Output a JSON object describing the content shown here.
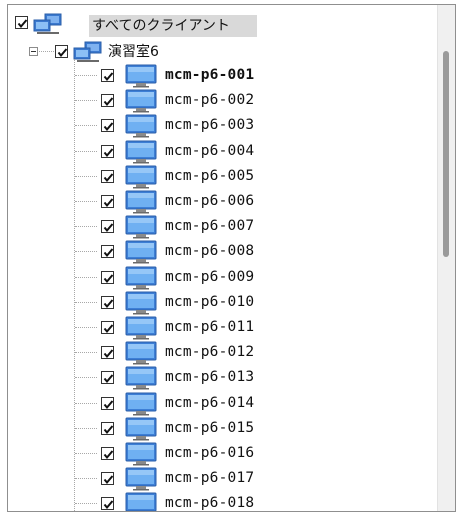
{
  "tree": {
    "root": {
      "label": "すべてのクライアント",
      "checked": true,
      "icon": "network-computers-icon"
    },
    "group": {
      "label": "演習室6",
      "checked": true,
      "expanded": true,
      "icon": "network-computers-icon"
    },
    "clients": [
      {
        "label": "mcm-p6-001",
        "checked": true,
        "selected": true
      },
      {
        "label": "mcm-p6-002",
        "checked": true
      },
      {
        "label": "mcm-p6-003",
        "checked": true
      },
      {
        "label": "mcm-p6-004",
        "checked": true
      },
      {
        "label": "mcm-p6-005",
        "checked": true
      },
      {
        "label": "mcm-p6-006",
        "checked": true
      },
      {
        "label": "mcm-p6-007",
        "checked": true
      },
      {
        "label": "mcm-p6-008",
        "checked": true
      },
      {
        "label": "mcm-p6-009",
        "checked": true
      },
      {
        "label": "mcm-p6-010",
        "checked": true
      },
      {
        "label": "mcm-p6-011",
        "checked": true
      },
      {
        "label": "mcm-p6-012",
        "checked": true
      },
      {
        "label": "mcm-p6-013",
        "checked": true
      },
      {
        "label": "mcm-p6-014",
        "checked": true
      },
      {
        "label": "mcm-p6-015",
        "checked": true
      },
      {
        "label": "mcm-p6-016",
        "checked": true
      },
      {
        "label": "mcm-p6-017",
        "checked": true
      },
      {
        "label": "mcm-p6-018",
        "checked": true
      }
    ]
  },
  "colors": {
    "monitor_blue": "#3d7fd6",
    "selection_gray": "#d9d9d9"
  }
}
